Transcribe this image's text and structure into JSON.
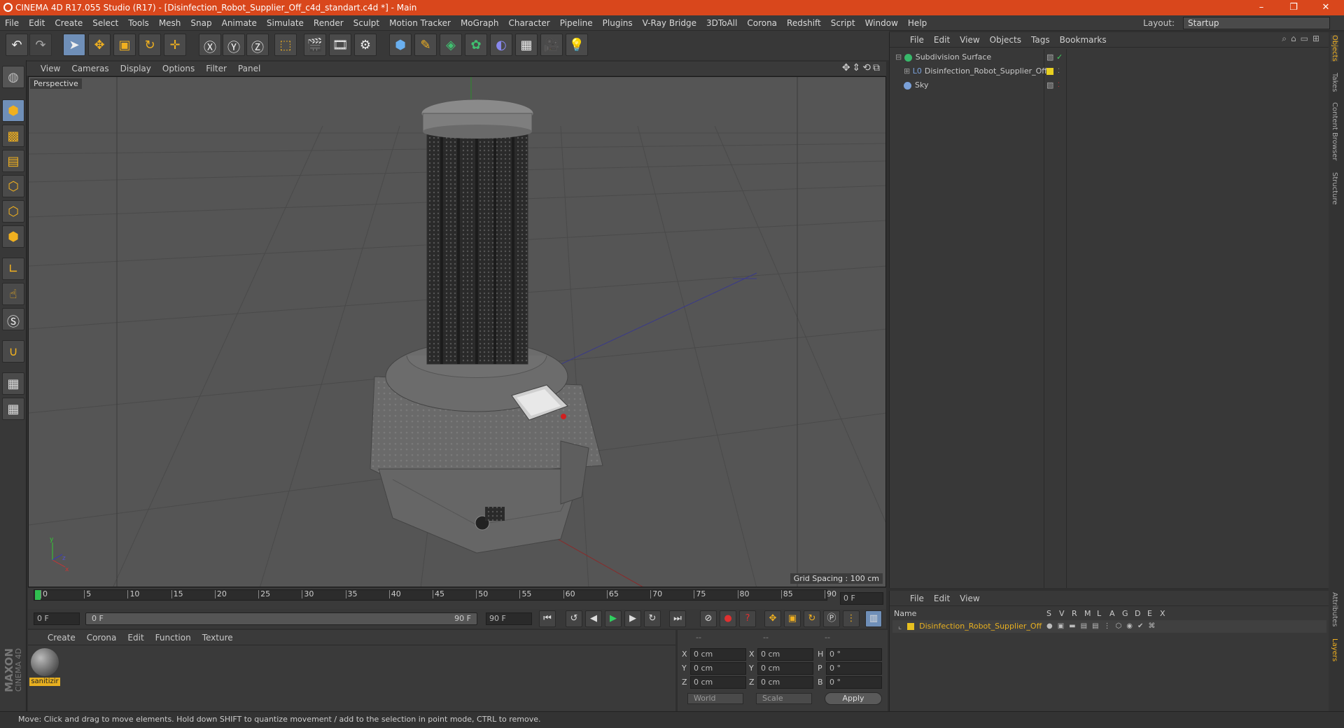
{
  "window": {
    "title": "CINEMA 4D R17.055 Studio (R17) - [Disinfection_Robot_Supplier_Off_c4d_standart.c4d *] - Main",
    "min_icon": "minimize-icon",
    "max_icon": "maximize-icon",
    "close_icon": "close-icon"
  },
  "menu": {
    "items": [
      "File",
      "Edit",
      "Create",
      "Select",
      "Tools",
      "Mesh",
      "Snap",
      "Animate",
      "Simulate",
      "Render",
      "Sculpt",
      "Motion Tracker",
      "MoGraph",
      "Character",
      "Pipeline",
      "Plugins",
      "V-Ray Bridge",
      "3DToAll",
      "Corona",
      "Redshift",
      "Script",
      "Window",
      "Help"
    ],
    "layout_label": "Layout:",
    "layout_value": "Startup"
  },
  "toolbar": {
    "icons": [
      "undo-icon",
      "redo-icon",
      "select-icon",
      "move-icon",
      "scale-icon",
      "rotate-icon",
      "live-select-icon",
      "x-axis-icon",
      "y-axis-icon",
      "z-axis-icon",
      "coordinate-system-icon",
      "render-view-icon",
      "render-picture-viewer-icon",
      "render-settings-icon",
      "cube-icon",
      "pen-icon",
      "subdivision-icon",
      "cloner-icon",
      "deformer-icon",
      "floor-icon",
      "camera-icon",
      "light-icon"
    ]
  },
  "viewport": {
    "menu": [
      "View",
      "Cameras",
      "Display",
      "Options",
      "Filter",
      "Panel"
    ],
    "label": "Perspective",
    "grid_spacing": "Grid Spacing : 100 cm"
  },
  "timeline": {
    "ticks": [
      "0",
      "5",
      "10",
      "15",
      "20",
      "25",
      "30",
      "35",
      "40",
      "45",
      "50",
      "55",
      "60",
      "65",
      "70",
      "75",
      "80",
      "85",
      "90"
    ],
    "current_frame": "0 F",
    "start_frame": "0 F",
    "range_start": "0 F",
    "range_end": "90 F",
    "end_frame": "90 F"
  },
  "material": {
    "menu": [
      "Create",
      "Corona",
      "Edit",
      "Function",
      "Texture"
    ],
    "name": "sanitizir"
  },
  "coords": {
    "headers": [
      "--",
      "--",
      "--"
    ],
    "rows": [
      {
        "a": "X",
        "av": "0 cm",
        "b": "X",
        "bv": "0 cm",
        "c": "H",
        "cv": "0 °"
      },
      {
        "a": "Y",
        "av": "0 cm",
        "b": "Y",
        "bv": "0 cm",
        "c": "P",
        "cv": "0 °"
      },
      {
        "a": "Z",
        "av": "0 cm",
        "b": "Z",
        "bv": "0 cm",
        "c": "B",
        "cv": "0 °"
      }
    ],
    "world": "World",
    "scale": "Scale",
    "apply": "Apply"
  },
  "objects": {
    "menu": [
      "File",
      "Edit",
      "View",
      "Objects",
      "Tags",
      "Bookmarks"
    ],
    "items": [
      {
        "name": "Subdivision Surface",
        "icon": "subdivision-icon",
        "color": "#38b86a"
      },
      {
        "name": "Disinfection_Robot_Supplier_Off",
        "icon": "null-object-icon",
        "color": "#7aa0d8"
      },
      {
        "name": "Sky",
        "icon": "sky-icon",
        "color": "#7aa0d8"
      }
    ]
  },
  "layers": {
    "menu": [
      "File",
      "Edit",
      "View"
    ],
    "columns": [
      "Name",
      "S",
      "V",
      "R",
      "M",
      "L",
      "A",
      "G",
      "D",
      "E",
      "X"
    ],
    "row_name": "Disinfection_Robot_Supplier_Off",
    "row_color": "#e8c020"
  },
  "right_tabs": [
    "Objects",
    "Takes",
    "Content Browser",
    "Structure",
    "Attributes",
    "Layers"
  ],
  "status": "Move: Click and drag to move elements. Hold down SHIFT to quantize movement / add to the selection in point mode, CTRL to remove.",
  "branding": {
    "maxon": "MAXON",
    "cinema": "CINEMA 4D"
  }
}
